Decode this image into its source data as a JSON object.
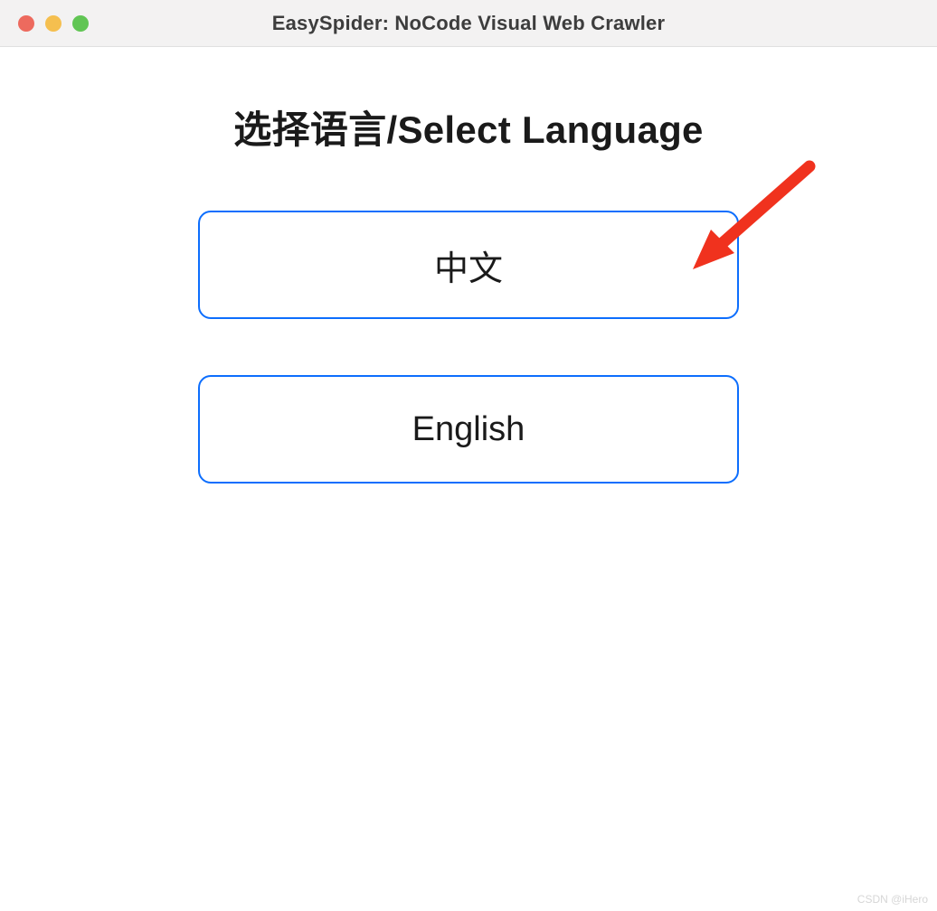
{
  "window": {
    "title": "EasySpider: NoCode Visual Web Crawler"
  },
  "main": {
    "heading": "选择语言/Select Language",
    "buttons": [
      {
        "label": "中文"
      },
      {
        "label": "English"
      }
    ]
  },
  "watermark": "CSDN @iHero",
  "colors": {
    "button_border": "#0d6efd",
    "arrow": "#f0321e"
  }
}
